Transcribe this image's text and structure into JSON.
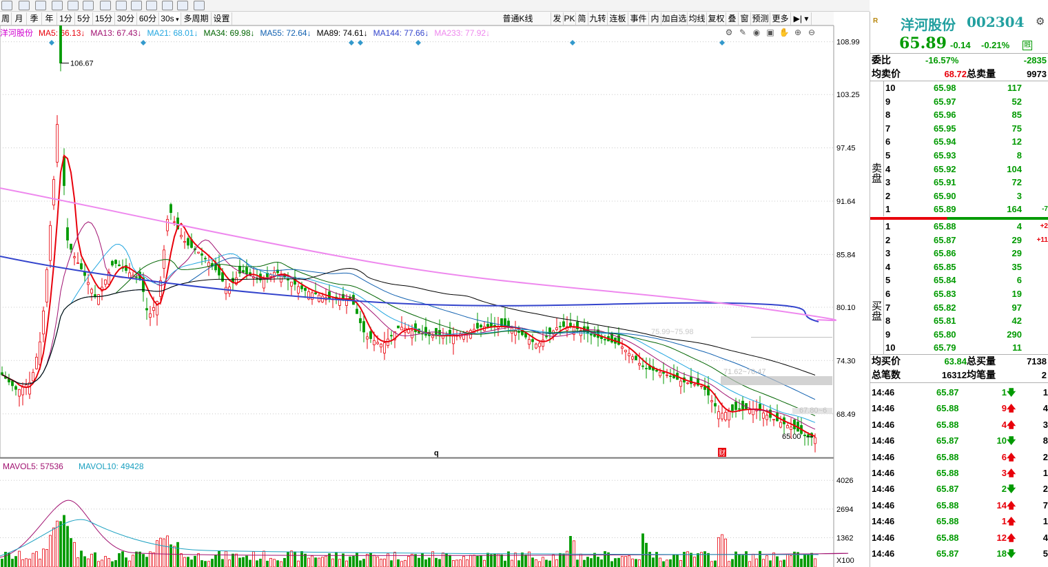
{
  "toolbar": {
    "period_buttons": [
      "周",
      "月",
      "季",
      "年",
      "1分",
      "5分",
      "15分",
      "30分",
      "60分",
      "30s",
      "多周期",
      "设置"
    ],
    "active_period": "30s",
    "right_buttons": [
      "普通K线",
      "发",
      "PK",
      "简",
      "九转",
      "连板",
      "事件",
      "内",
      "加自选",
      "均线",
      "复权",
      "叠",
      "窗",
      "预测",
      "更多"
    ]
  },
  "stock": {
    "name": "洋河股份",
    "code": "002304",
    "price": "65.89",
    "change": "-0.14",
    "change_pct": "-0.21%",
    "badge": "R"
  },
  "ma_legend": [
    {
      "label": "洋河股份",
      "color": "#d000d0"
    },
    {
      "label": "MA5: 66.13",
      "color": "#e8000b"
    },
    {
      "label": "MA13: 67.43",
      "color": "#a01070"
    },
    {
      "label": "MA21: 68.01",
      "color": "#22a6e0"
    },
    {
      "label": "MA34: 69.98",
      "color": "#006400"
    },
    {
      "label": "MA55: 72.64",
      "color": "#1060b0"
    },
    {
      "label": "MA89: 74.61",
      "color": "#000000"
    },
    {
      "label": "MA144: 77.66",
      "color": "#3344cc"
    },
    {
      "label": "MA233: 77.92",
      "color": "#ee88ee"
    }
  ],
  "vol_legend": [
    {
      "label": "MAVOL5: 57536",
      "color": "#a01070"
    },
    {
      "label": "MAVOL10: 49428",
      "color": "#1aa0c0"
    }
  ],
  "chart_data": {
    "type": "candlestick",
    "price_axis": [
      "108.99",
      "103.25",
      "97.45",
      "91.64",
      "85.84",
      "80.10",
      "74.30",
      "68.49"
    ],
    "volume_axis": [
      "4026",
      "2694",
      "1362",
      "X100"
    ],
    "annotations": {
      "high": "106.67",
      "low": "65.00",
      "band1": "71.62~70.47",
      "band2": "67.80~6",
      "band3": "75.99~75.98"
    },
    "markers": [
      "q",
      "财"
    ]
  },
  "quote": {
    "weibi_label": "委比",
    "weibi_pct": "-16.57%",
    "weibi_val": "-2835",
    "avg_sell_label": "均卖价",
    "avg_sell": "68.72",
    "total_sell_label": "总卖量",
    "total_sell": "9973",
    "sell_side_label": "卖盘",
    "buy_side_label": "买盘",
    "asks": [
      {
        "lvl": "10",
        "price": "65.98",
        "vol": "117",
        "chg": ""
      },
      {
        "lvl": "9",
        "price": "65.97",
        "vol": "52",
        "chg": ""
      },
      {
        "lvl": "8",
        "price": "65.96",
        "vol": "85",
        "chg": ""
      },
      {
        "lvl": "7",
        "price": "65.95",
        "vol": "75",
        "chg": ""
      },
      {
        "lvl": "6",
        "price": "65.94",
        "vol": "12",
        "chg": ""
      },
      {
        "lvl": "5",
        "price": "65.93",
        "vol": "8",
        "chg": ""
      },
      {
        "lvl": "4",
        "price": "65.92",
        "vol": "104",
        "chg": ""
      },
      {
        "lvl": "3",
        "price": "65.91",
        "vol": "72",
        "chg": ""
      },
      {
        "lvl": "2",
        "price": "65.90",
        "vol": "3",
        "chg": ""
      },
      {
        "lvl": "1",
        "price": "65.89",
        "vol": "164",
        "chg": "-7"
      }
    ],
    "bids": [
      {
        "lvl": "1",
        "price": "65.88",
        "vol": "4",
        "chg": "+2"
      },
      {
        "lvl": "2",
        "price": "65.87",
        "vol": "29",
        "chg": "+11"
      },
      {
        "lvl": "3",
        "price": "65.86",
        "vol": "29",
        "chg": ""
      },
      {
        "lvl": "4",
        "price": "65.85",
        "vol": "35",
        "chg": ""
      },
      {
        "lvl": "5",
        "price": "65.84",
        "vol": "6",
        "chg": ""
      },
      {
        "lvl": "6",
        "price": "65.83",
        "vol": "19",
        "chg": ""
      },
      {
        "lvl": "7",
        "price": "65.82",
        "vol": "97",
        "chg": ""
      },
      {
        "lvl": "8",
        "price": "65.81",
        "vol": "42",
        "chg": ""
      },
      {
        "lvl": "9",
        "price": "65.80",
        "vol": "290",
        "chg": ""
      },
      {
        "lvl": "10",
        "price": "65.79",
        "vol": "11",
        "chg": ""
      }
    ],
    "avg_buy_label": "均买价",
    "avg_buy": "63.84",
    "total_buy_label": "总买量",
    "total_buy": "7138",
    "total_trades_label": "总笔数",
    "total_trades": "16312",
    "avg_trade_label": "均笔量",
    "avg_trade": "2",
    "ticks": [
      {
        "time": "14:46",
        "price": "65.87",
        "vol": "1",
        "dir": "down",
        "n": "1"
      },
      {
        "time": "14:46",
        "price": "65.88",
        "vol": "9",
        "dir": "up",
        "n": "4"
      },
      {
        "time": "14:46",
        "price": "65.88",
        "vol": "4",
        "dir": "up",
        "n": "3"
      },
      {
        "time": "14:46",
        "price": "65.87",
        "vol": "10",
        "dir": "down",
        "n": "8"
      },
      {
        "time": "14:46",
        "price": "65.88",
        "vol": "6",
        "dir": "up",
        "n": "2"
      },
      {
        "time": "14:46",
        "price": "65.88",
        "vol": "3",
        "dir": "up",
        "n": "1"
      },
      {
        "time": "14:46",
        "price": "65.87",
        "vol": "2",
        "dir": "down",
        "n": "2"
      },
      {
        "time": "14:46",
        "price": "65.88",
        "vol": "14",
        "dir": "up",
        "n": "7"
      },
      {
        "time": "14:46",
        "price": "65.88",
        "vol": "1",
        "dir": "up",
        "n": "1"
      },
      {
        "time": "14:46",
        "price": "65.88",
        "vol": "12",
        "dir": "up",
        "n": "4"
      },
      {
        "time": "14:46",
        "price": "65.87",
        "vol": "18",
        "dir": "down",
        "n": "5"
      }
    ]
  }
}
